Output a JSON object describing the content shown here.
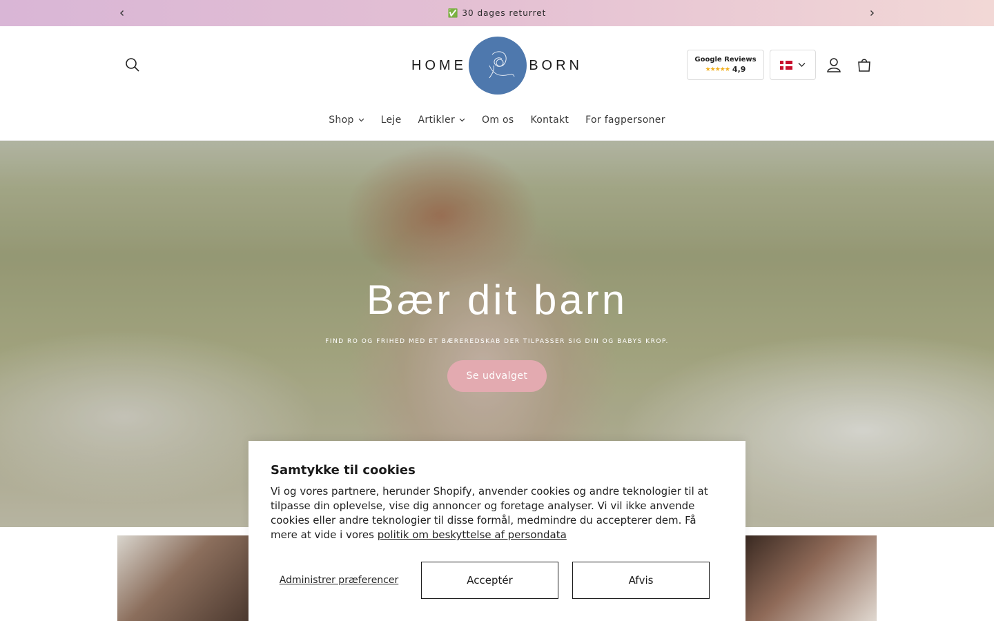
{
  "announcement": {
    "text": "✅ 30 dages returret"
  },
  "header": {
    "logo_left": "HOME",
    "logo_right": "BORN",
    "reviews": {
      "title": "Google Reviews",
      "stars": "★★★★★",
      "score": "4,9"
    }
  },
  "nav": {
    "items": [
      {
        "label": "Shop",
        "dropdown": true
      },
      {
        "label": "Leje",
        "dropdown": false
      },
      {
        "label": "Artikler",
        "dropdown": true
      },
      {
        "label": "Om os",
        "dropdown": false
      },
      {
        "label": "Kontakt",
        "dropdown": false
      },
      {
        "label": "For fagpersoner",
        "dropdown": false
      }
    ]
  },
  "hero": {
    "title": "Bær dit barn",
    "subtitle": "FIND RO OG FRIHED MED ET BÆREREDSKAB DER TILPASSER SIG DIN OG BABYS KROP.",
    "cta": "Se udvalget"
  },
  "cookie": {
    "title": "Samtykke til cookies",
    "body": "Vi og vores partnere, herunder Shopify, anvender cookies og andre teknologier til at tilpasse din oplevelse, vise dig annoncer og foretage analyser. Vi vil ikke anvende cookies eller andre teknologier til disse formål, medmindre du accepterer dem. Få mere at vide i vores ",
    "link": "politik om beskyttelse af persondata",
    "manage": "Administrer præferencer",
    "accept": "Acceptér",
    "decline": "Afvis"
  },
  "colors": {
    "announcement_gradient_start": "#d9b6d6",
    "announcement_gradient_end": "#f2d8d6",
    "logo_circle": "#4e78ad",
    "cta_pink": "#e3aab0"
  }
}
